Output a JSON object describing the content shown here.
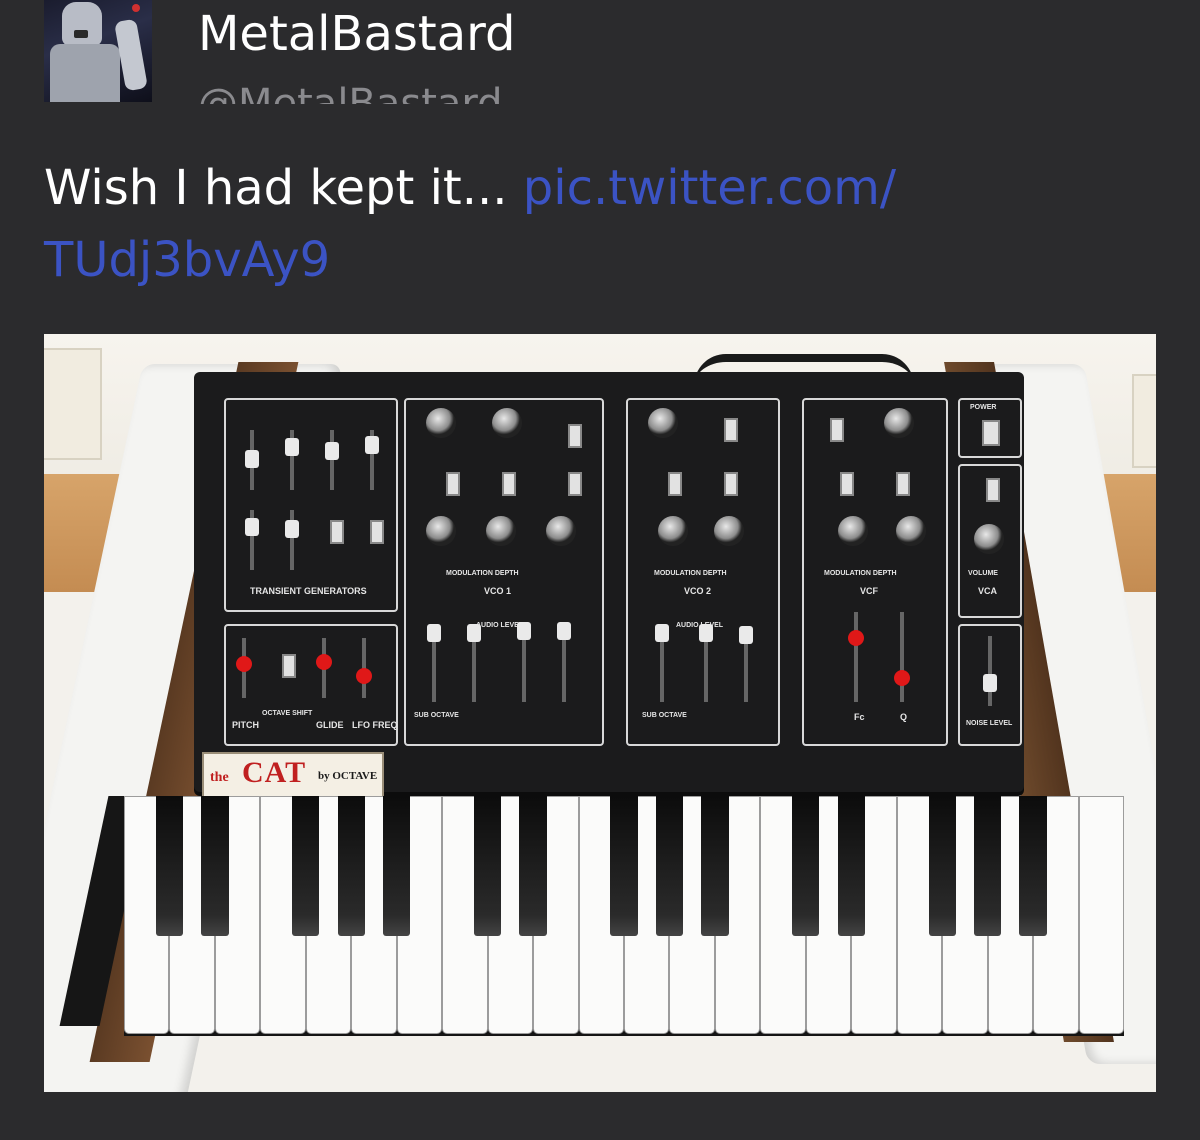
{
  "author": {
    "display_name": "MetalBastard",
    "handle": "@MetalBastard"
  },
  "tweet": {
    "text": "Wish I had kept it... ",
    "link_text": "pic.twitter.com/\nTUdj3bvAy9"
  },
  "photo": {
    "logo_the": "the",
    "logo_cat": "CAT",
    "logo_octave": "by OCTAVE",
    "labels": {
      "transient": "TRANSIENT GENERATORS",
      "vco1": "VCO 1",
      "vco2": "VCO 2",
      "vcf": "VCF",
      "vca": "VCA",
      "mod_depth": "MODULATION DEPTH",
      "audio_level": "AUDIO LEVEL",
      "pitch": "PITCH",
      "octave_shift": "OCTAVE SHIFT",
      "glide": "GLIDE",
      "lfo_freq": "LFO FREQ",
      "sub_octave": "SUB OCTAVE",
      "noise_level": "NOISE LEVEL",
      "power": "POWER",
      "volume": "VOLUME",
      "fc": "Fc",
      "q": "Q"
    }
  },
  "colors": {
    "background": "#2b2b2d",
    "text": "#ffffff",
    "handle": "#8a8a8e",
    "link": "#3b53c4"
  }
}
